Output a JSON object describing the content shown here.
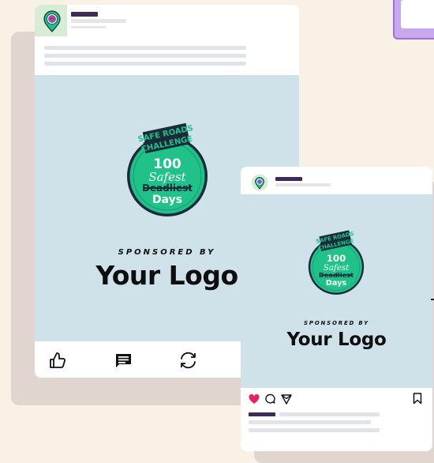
{
  "badge": {
    "top_text_1": "SAFE ROADS",
    "top_text_2": "CHALLENGE",
    "number": "100",
    "script_word": "Safest",
    "struck_word": "Deadliest",
    "days": "Days"
  },
  "card1": {
    "sponsored_label": "SPONSORED BY",
    "logo_text": "Your Logo",
    "actions": [
      "thumbs-up-icon",
      "comment-icon",
      "share-icon"
    ]
  },
  "card2": {
    "sponsored_label": "SPONSORED BY",
    "logo_text": "Your Logo",
    "actions": [
      "heart-icon",
      "comment-icon",
      "send-icon",
      "bookmark-icon"
    ]
  },
  "colors": {
    "badge_green": "#21c18a",
    "badge_ring": "#1a2b3a",
    "hero_bg": "#cfe2ea",
    "heart": "#e6245d",
    "name_bar": "#3e2a57",
    "background": "#faf1e6"
  }
}
